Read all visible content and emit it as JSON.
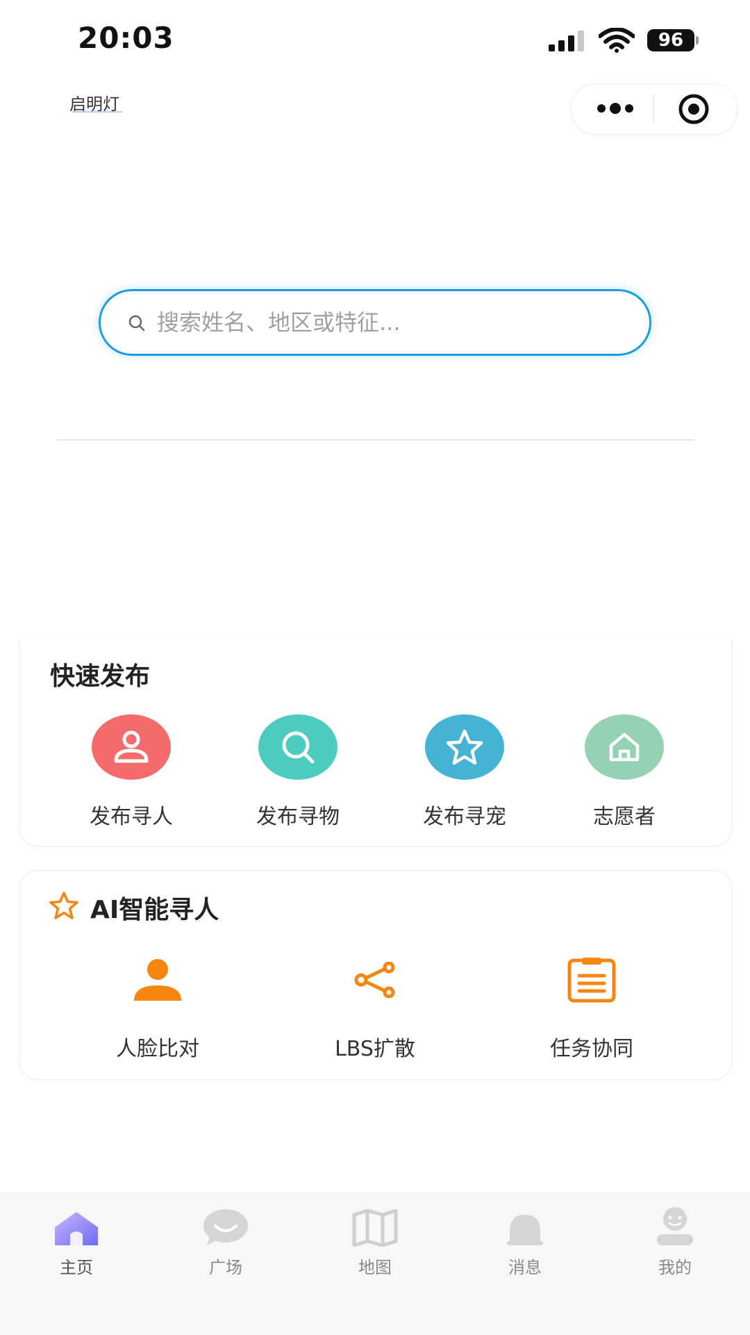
{
  "status_bar": {
    "time": "20:03",
    "battery": "96"
  },
  "app": {
    "title": "启明灯"
  },
  "search": {
    "placeholder": "搜索姓名、地区或特征..."
  },
  "quick_publish": {
    "title": "快速发布",
    "items": [
      {
        "label": "发布寻人",
        "icon": "person-icon",
        "color": "#f56b6b"
      },
      {
        "label": "发布寻物",
        "icon": "search-icon",
        "color": "#4ecbbf"
      },
      {
        "label": "发布寻宠",
        "icon": "star-icon",
        "color": "#45b3d4"
      },
      {
        "label": "志愿者",
        "icon": "home-icon",
        "color": "#96d1b4"
      }
    ]
  },
  "ai_search": {
    "title": "AI智能寻人",
    "items": [
      {
        "label": "人脸比对",
        "icon": "person-icon"
      },
      {
        "label": "LBS扩散",
        "icon": "share-icon"
      },
      {
        "label": "任务协同",
        "icon": "clipboard-icon"
      }
    ],
    "accent_color": "#f5860f"
  },
  "tabbar": {
    "items": [
      {
        "label": "主页",
        "icon": "home-icon",
        "active": true
      },
      {
        "label": "广场",
        "icon": "chat-bubble-icon"
      },
      {
        "label": "地图",
        "icon": "map-icon"
      },
      {
        "label": "消息",
        "icon": "bell-icon"
      },
      {
        "label": "我的",
        "icon": "user-icon"
      }
    ]
  }
}
